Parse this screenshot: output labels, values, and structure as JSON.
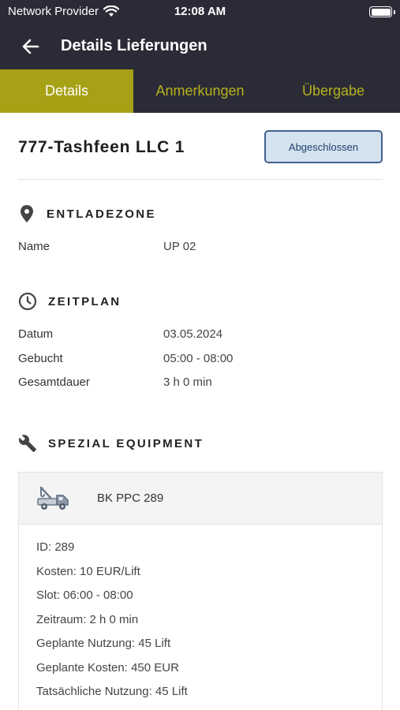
{
  "status_bar": {
    "provider": "Network Provider",
    "time": "12:08 AM"
  },
  "app_bar": {
    "title": "Details Lieferungen"
  },
  "tabs": [
    {
      "label": "Details",
      "active": true
    },
    {
      "label": "Anmerkungen",
      "active": false
    },
    {
      "label": "Übergabe",
      "active": false
    }
  ],
  "delivery": {
    "title": "777-Tashfeen LLC 1",
    "status_label": "Abgeschlossen"
  },
  "unloading_zone": {
    "heading": "ENTLADEZONE",
    "rows": [
      {
        "label": "Name",
        "value": "UP 02"
      }
    ]
  },
  "schedule": {
    "heading": "ZEITPLAN",
    "rows": [
      {
        "label": "Datum",
        "value": "03.05.2024"
      },
      {
        "label": "Gebucht",
        "value": "05:00 - 08:00"
      },
      {
        "label": "Gesamtdauer",
        "value": "3 h 0 min"
      }
    ]
  },
  "special_equipment": {
    "heading": "SPEZIAL EQUIPMENT",
    "item": {
      "name": "BK PPC 289",
      "details": [
        "ID: 289",
        "Kosten: 10 EUR/Lift",
        "Slot: 06:00 - 08:00",
        "Zeitraum: 2 h 0 min",
        "Geplante Nutzung: 45 Lift",
        "Geplante Kosten: 450 EUR",
        "Tatsächliche Nutzung: 45 Lift"
      ]
    }
  },
  "colors": {
    "app_bar": "#2a2b36",
    "tab_active": "#a7a115",
    "tab_inactive_text": "#b7b21b",
    "status_button_bg": "#d3e2ef",
    "status_button_border": "#42608b"
  }
}
